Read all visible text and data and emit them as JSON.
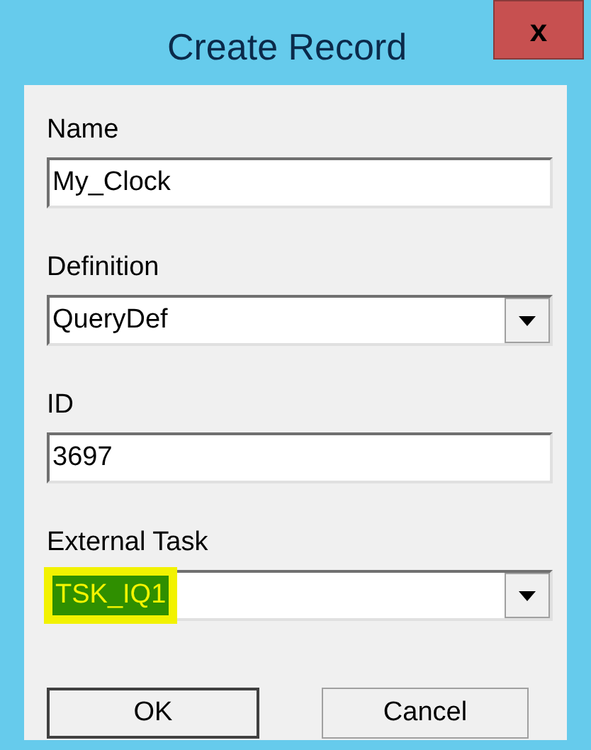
{
  "window": {
    "title": "Create Record",
    "close": "x"
  },
  "fields": [
    {
      "label": "Name",
      "kind": "text",
      "value": "My_Clock",
      "highlighted": false
    },
    {
      "label": "Definition",
      "kind": "combo",
      "value": "QueryDef",
      "highlighted": false
    },
    {
      "label": "ID",
      "kind": "text",
      "value": "3697",
      "highlighted": false
    },
    {
      "label": "External Task",
      "kind": "combo",
      "value": "TSK_IQ1",
      "highlighted": true
    }
  ],
  "buttons": [
    {
      "label": "OK",
      "default": true
    },
    {
      "label": "Cancel",
      "default": false
    }
  ]
}
